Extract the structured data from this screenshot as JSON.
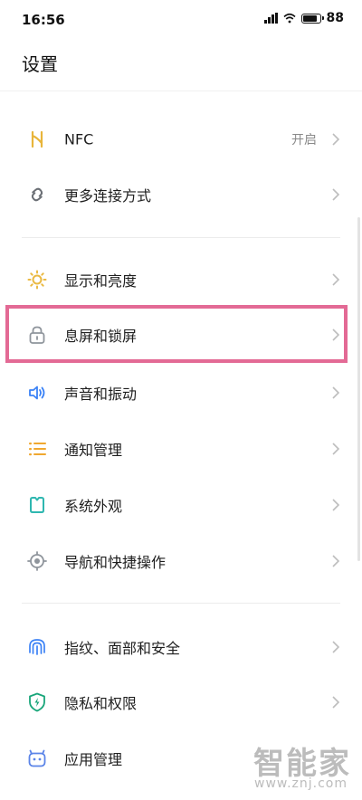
{
  "status": {
    "time": "16:56",
    "battery": "88"
  },
  "title": "设置",
  "items": [
    {
      "label": "NFC",
      "value": "开启",
      "icon": "nfc-icon"
    },
    {
      "label": "更多连接方式",
      "icon": "link-icon"
    },
    {
      "label": "显示和亮度",
      "icon": "sun-icon"
    },
    {
      "label": "息屏和锁屏",
      "icon": "lock-icon"
    },
    {
      "label": "声音和振动",
      "icon": "speaker-icon"
    },
    {
      "label": "通知管理",
      "icon": "list-icon"
    },
    {
      "label": "系统外观",
      "icon": "theme-icon"
    },
    {
      "label": "导航和快捷操作",
      "icon": "navigation-icon"
    },
    {
      "label": "指纹、面部和安全",
      "icon": "fingerprint-icon"
    },
    {
      "label": "隐私和权限",
      "icon": "shield-icon"
    },
    {
      "label": "应用管理",
      "icon": "app-icon"
    }
  ],
  "watermark": {
    "big": "智能家",
    "small": "www.znj.com"
  },
  "colors": {
    "highlight": "#e36a95",
    "nfc": "#e8b53b",
    "link": "#6b6f75",
    "sun": "#eab942",
    "lock": "#8f959c",
    "sound": "#3b82f6",
    "notify": "#f0a830",
    "theme": "#2fb7b0",
    "nav": "#8f959c",
    "fingerprint": "#3b82f6",
    "shield": "#19a67a",
    "app": "#5b84e8"
  }
}
